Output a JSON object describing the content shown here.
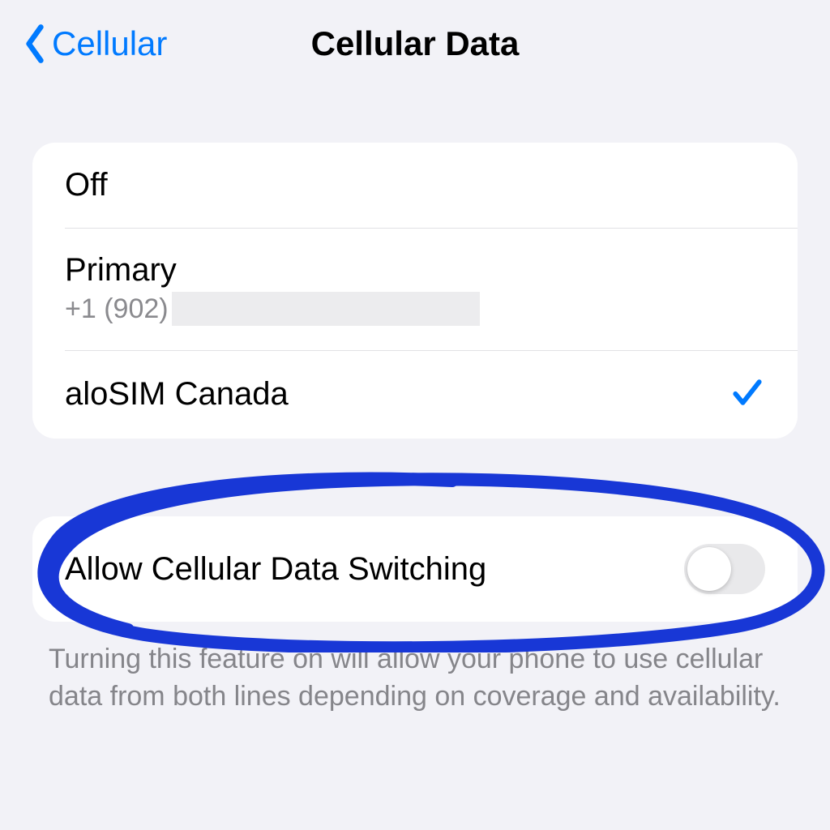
{
  "nav": {
    "back_label": "Cellular",
    "title": "Cellular Data"
  },
  "options": {
    "off_label": "Off",
    "primary_label": "Primary",
    "primary_number_prefix": "+1 (902)",
    "alosim_label": "aloSIM Canada",
    "selected": "alosim"
  },
  "switching": {
    "label": "Allow Cellular Data Switching",
    "enabled": false,
    "footer": "Turning this feature on will allow your phone to use cellular data from both lines depending on coverage and availability."
  },
  "colors": {
    "accent": "#007aff",
    "annotation": "#1837d6"
  }
}
